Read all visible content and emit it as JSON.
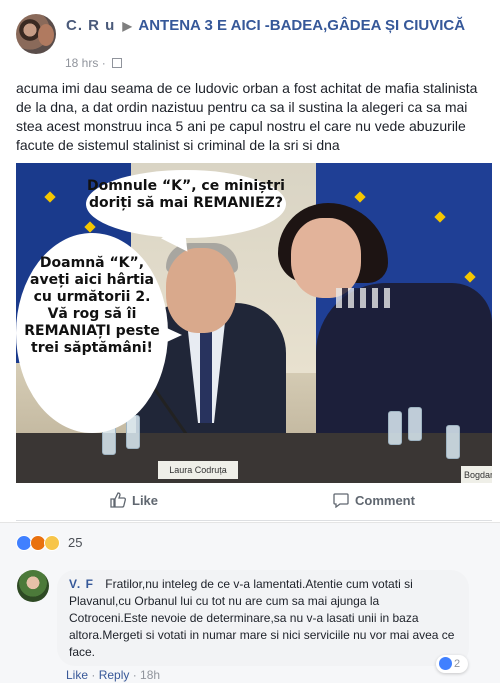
{
  "post": {
    "author": "C. R u",
    "arrow": "▶",
    "group": "ANTENA 3 E AICI -BADEA,GÂDEA ȘI CIUVICĂ",
    "time": "18 hrs",
    "text": "acuma imi dau seama de ce ludovic orban a fost achitat de mafia stalinista de la dna, a dat ordin nazistuu pentru ca sa il sustina la alegeri ca sa mai stea acest monstruu inca 5 ani pe capul nostru el care nu vede abuzurile facute de sistemul stalinist si criminal de la sri si dna"
  },
  "image": {
    "bubble_top": "Domnule “K”, ce miniștri doriți să mai REMANIEZ?",
    "bubble_left": "Doamnă “K”, aveți aici hârtia cu următorii 2. Vă rog să îi REMANIAȚI peste trei săptămâni!",
    "nameplate_left": "Laura Codruța",
    "nameplate_right": "Bogdan"
  },
  "actions": {
    "like": "Like",
    "comment": "Comment"
  },
  "reactions": {
    "count": "25"
  },
  "comment": {
    "author": "V. F",
    "text": "Fratilor,nu inteleg de ce v-a lamentati.Atentie cum votati si Plavanul,cu Orbanul lui cu tot nu are cum sa mai ajunga la Cotroceni.Este nevoie de determinare,sa nu v-a lasati unii in baza altora.Mergeti si votati in numar mare si nici serviciile nu vor mai avea ce face.",
    "likes": "2",
    "like_label": "Like",
    "reply_label": "Reply",
    "time": "18h"
  },
  "colors": {
    "link": "#365899",
    "muted": "#90949c",
    "like_blue": "#4080ff"
  }
}
